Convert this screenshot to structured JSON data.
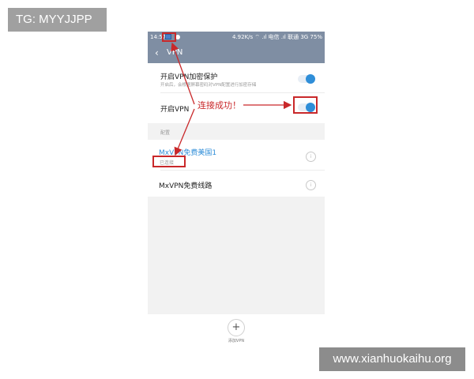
{
  "watermarks": {
    "tg": "TG: MYYJJPP",
    "site": "www.xianhuokaihu.org"
  },
  "status_bar": {
    "time": "14:57",
    "right_text": "4.92K/s  ⌔ .ıl 电信 .ıl 联通 3G  75%"
  },
  "header": {
    "back_icon": "chevron-left-icon",
    "title": "VPN"
  },
  "settings": {
    "encrypt_protect": {
      "label": "开启VPN加密保护",
      "sub": "开启后，会根据屏幕密码对VPN配置进行加密存储",
      "on": true
    },
    "enable_vpn": {
      "label": "开启VPN",
      "on": true
    }
  },
  "section": {
    "label": "配置"
  },
  "vpn_list": [
    {
      "name": "MxVPN免费美国1",
      "status": "已连接",
      "active": true
    },
    {
      "name": "MxVPN免费线路",
      "status": "",
      "active": false
    }
  ],
  "info_button_glyph": "i",
  "footer": {
    "add_icon": "+",
    "add_label": "添加VPN"
  },
  "annotation": {
    "text": "连接成功！",
    "color": "#c9282a"
  },
  "colors": {
    "header_bg": "#7f8ea3",
    "accent": "#2f8ed8"
  }
}
